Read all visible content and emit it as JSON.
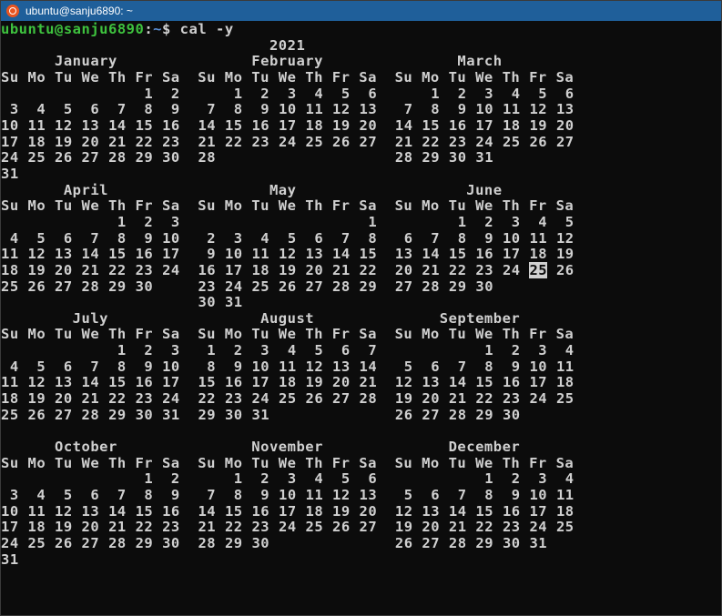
{
  "window": {
    "title": "ubuntu@sanju6890: ~"
  },
  "prompt": {
    "user_host": "ubuntu@sanju6890",
    "separator": ":",
    "path": "~",
    "sign": "$",
    "command": " cal -y"
  },
  "calendar": {
    "year": "2021",
    "weekday_header": "Su Mo Tu We Th Fr Sa",
    "highlighted_day": {
      "month": "June",
      "day": "25"
    },
    "months": [
      {
        "name": "January",
        "first_weekday": 5,
        "days": 31
      },
      {
        "name": "February",
        "first_weekday": 1,
        "days": 28
      },
      {
        "name": "March",
        "first_weekday": 1,
        "days": 31
      },
      {
        "name": "April",
        "first_weekday": 4,
        "days": 30
      },
      {
        "name": "May",
        "first_weekday": 6,
        "days": 31
      },
      {
        "name": "June",
        "first_weekday": 2,
        "days": 30
      },
      {
        "name": "July",
        "first_weekday": 4,
        "days": 31
      },
      {
        "name": "August",
        "first_weekday": 0,
        "days": 31
      },
      {
        "name": "September",
        "first_weekday": 3,
        "days": 30
      },
      {
        "name": "October",
        "first_weekday": 5,
        "days": 31
      },
      {
        "name": "November",
        "first_weekday": 1,
        "days": 30
      },
      {
        "name": "December",
        "first_weekday": 3,
        "days": 31
      }
    ]
  }
}
